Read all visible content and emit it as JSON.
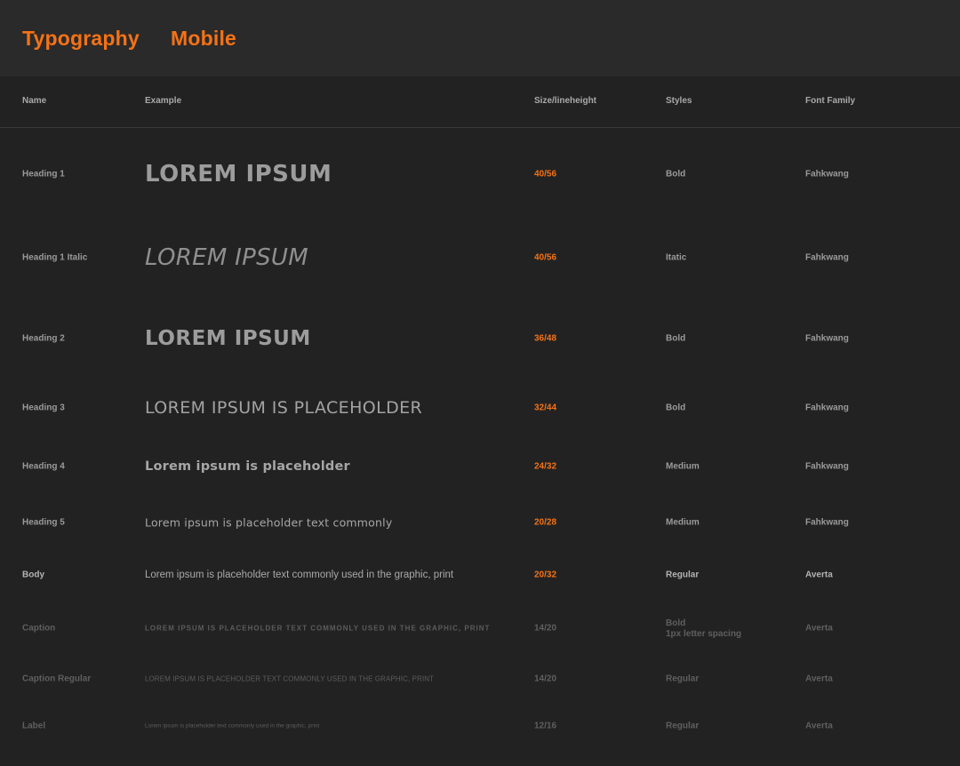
{
  "header": {
    "title": "Typography",
    "subtitle": "Mobile"
  },
  "columns": {
    "name": "Name",
    "example": "Example",
    "size": "Size/lineheight",
    "styles": "Styles",
    "family": "Font Family"
  },
  "rows": [
    {
      "name": "Heading 1",
      "example": "LOREM IPSUM",
      "size": "40/56",
      "style": "Bold",
      "family": "Fahkwang"
    },
    {
      "name": "Heading 1 Italic",
      "example": "LOREM IPSUM",
      "size": "40/56",
      "style": "Itatic",
      "family": "Fahkwang"
    },
    {
      "name": "Heading 2",
      "example": "LOREM IPSUM",
      "size": "36/48",
      "style": "Bold",
      "family": "Fahkwang"
    },
    {
      "name": "Heading 3",
      "example": "LOREM IPSUM IS PLACEHOLDER",
      "size": "32/44",
      "style": "Bold",
      "family": "Fahkwang"
    },
    {
      "name": "Heading 4",
      "example": "Lorem ipsum is placeholder",
      "size": "24/32",
      "style": "Medium",
      "family": "Fahkwang"
    },
    {
      "name": "Heading 5",
      "example": "Lorem ipsum is placeholder text commonly",
      "size": "20/28",
      "style": "Medium",
      "family": "Fahkwang"
    },
    {
      "name": "Body",
      "example": "Lorem ipsum is placeholder text commonly used in the graphic, print",
      "size": "20/32",
      "style": "Regular",
      "family": "Averta"
    },
    {
      "name": "Caption",
      "example": "LOREM IPSUM IS PLACEHOLDER TEXT COMMONLY USED IN THE GRAPHIC, PRINT",
      "size": "14/20",
      "style": "Bold",
      "style_note": "1px letter spacing",
      "family": "Averta"
    },
    {
      "name": "Caption Regular",
      "example": "LOREM IPSUM IS PLACEHOLDER TEXT COMMONLY USED IN THE GRAPHIC, PRINT",
      "size": "14/20",
      "style": "Regular",
      "family": "Averta"
    },
    {
      "name": "Label",
      "example": "Lorem ipsum is placeholder text commonly used in the graphic, print",
      "size": "12/16",
      "style": "Regular",
      "family": "Averta"
    }
  ],
  "colors": {
    "accent": "#f47216",
    "background": "#232222",
    "topbar": "#2a2a2a"
  }
}
